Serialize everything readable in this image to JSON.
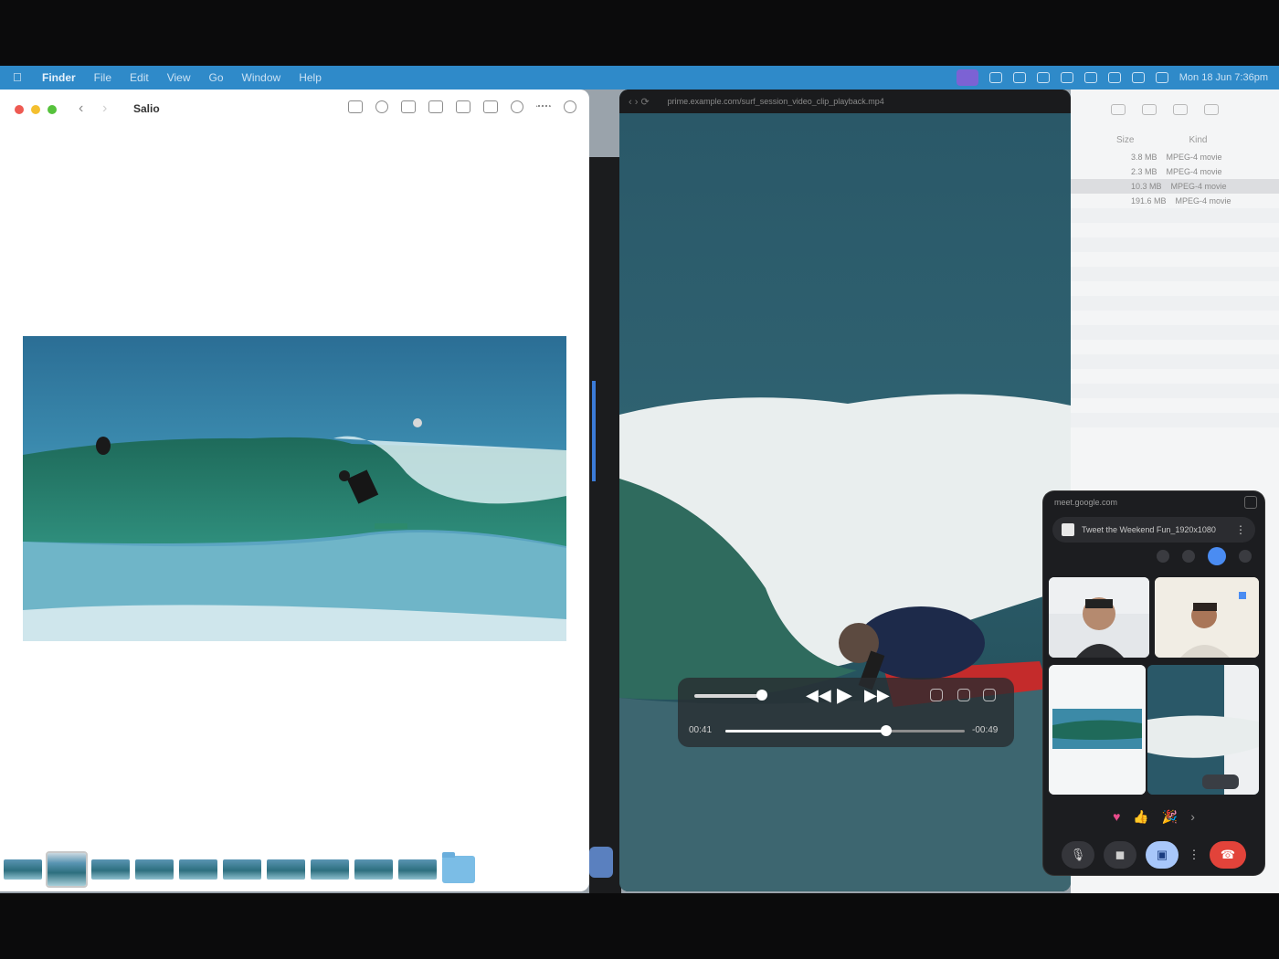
{
  "menubar": {
    "app_name": "Finder",
    "menus": [
      "File",
      "Edit",
      "View",
      "Go",
      "Window",
      "Help"
    ],
    "clock": "Mon 18 Jun 7:36pm"
  },
  "preview": {
    "title": "Salio",
    "back": "‹",
    "forward": "›",
    "thumbnail_count": 10
  },
  "video": {
    "url": "prime.example.com/surf_session_video_clip_playback.mp4",
    "player": {
      "rewind": "◀◀",
      "play": "▶",
      "forward": "▶▶",
      "time_elapsed": "00:41",
      "time_remaining": "-00:49",
      "progress": 0.67,
      "volume": 0.8
    }
  },
  "finder": {
    "headers": [
      "Size",
      "Kind"
    ],
    "rows": [
      {
        "size": "3.8 MB",
        "kind": "MPEG-4 movie"
      },
      {
        "size": "2.3 MB",
        "kind": "MPEG-4 movie"
      },
      {
        "size": "10.3 MB",
        "kind": "MPEG-4 movie"
      },
      {
        "size": "191.6 MB",
        "kind": "MPEG-4 movie"
      }
    ]
  },
  "meet": {
    "top_label": "meet.google.com",
    "share_label": "Tweet the Weekend Fun_1920x1080",
    "more": "⋮",
    "reactions": [
      "♥",
      "👍",
      "🎉",
      "›"
    ],
    "controls": {
      "mic": "🎙",
      "camera": "◼",
      "present": "▣",
      "more": "⋮",
      "end": "☎"
    }
  },
  "colors": {
    "menubar": "#2f8ac9",
    "accent_blue": "#4a8cf2",
    "end_call": "#e2433a",
    "present_active": "#a8c7fa"
  }
}
